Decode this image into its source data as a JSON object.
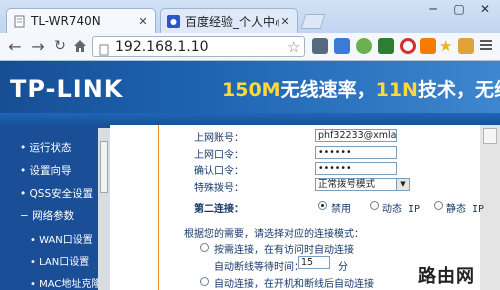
{
  "browser": {
    "tabs": [
      {
        "title": "TL-WR740N",
        "active": true
      },
      {
        "title": "百度经验_个人中心_",
        "active": false
      }
    ],
    "url": "192.168.1.10"
  },
  "router": {
    "logo": "TP-LINK",
    "slogan_part1": "150M",
    "slogan_part2": "无线速率，",
    "slogan_part3": "11N",
    "slogan_part4": "技术，无线"
  },
  "sidebar": {
    "items": [
      {
        "label": "运行状态"
      },
      {
        "label": "设置向导"
      },
      {
        "label": "QSS安全设置"
      },
      {
        "label": "网络参数"
      }
    ],
    "subitems": [
      {
        "label": "WAN口设置"
      },
      {
        "label": "LAN口设置"
      },
      {
        "label": "MAC地址克隆"
      }
    ]
  },
  "form": {
    "account_label": "上网账号：",
    "account_value": "phf32233@xmlan",
    "password_label": "上网口令：",
    "password_value": "••••••",
    "confirm_label": "确认口令：",
    "confirm_value": "••••••",
    "dial_label": "特殊拨号：",
    "dial_value": "正常拨号模式",
    "second_conn_label": "第二连接：",
    "second_conn_options": [
      "禁用",
      "动态 IP",
      "静态 IP"
    ],
    "note": "根据您的需要，请选择对应的连接模式：",
    "option1": "按需连接，在有访问时自动连接",
    "idle_label": "自动断线等待时间：",
    "idle_value": "15",
    "idle_unit": "分",
    "option2": "自动连接，在开机和断线后自动连接"
  },
  "watermark": "路由网"
}
